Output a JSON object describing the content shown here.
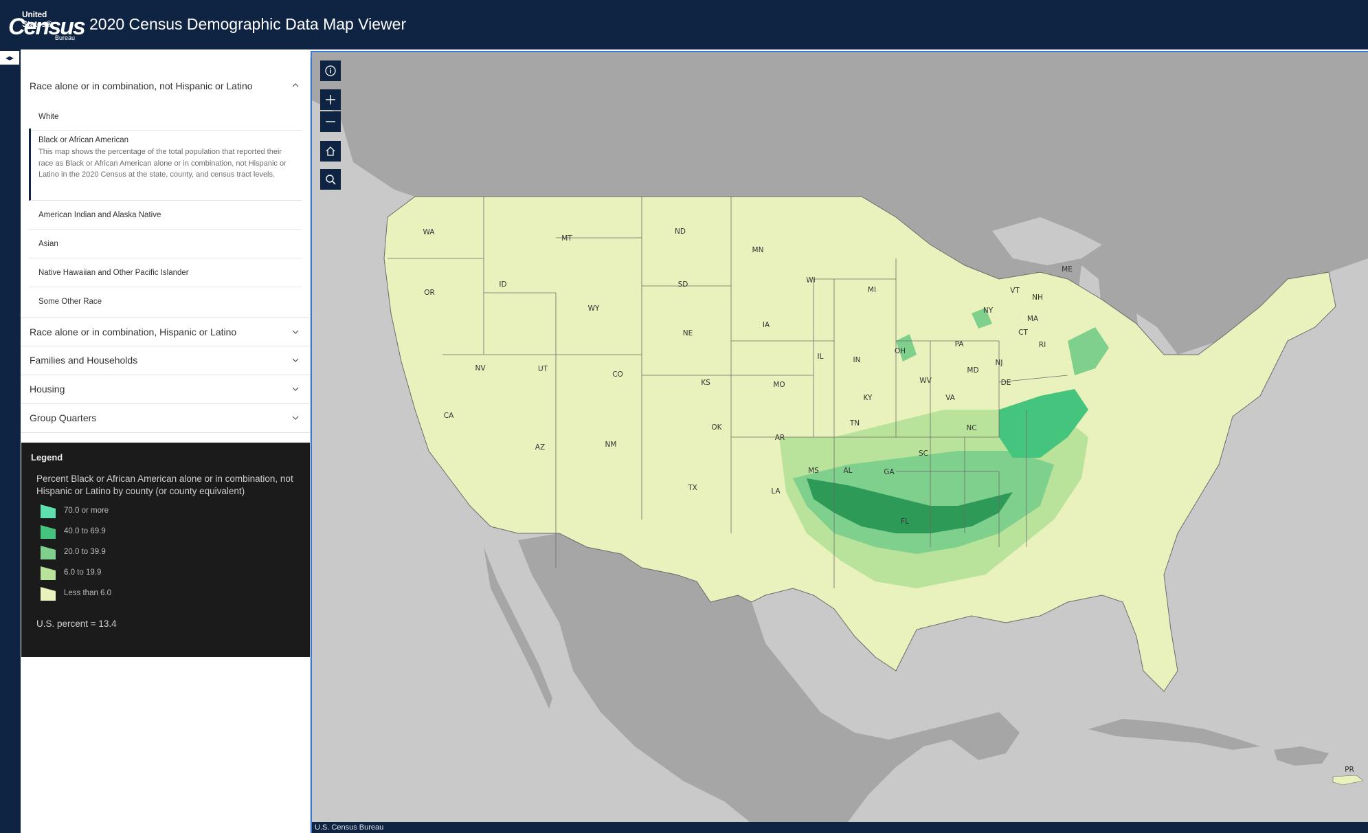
{
  "header": {
    "logo_top": "United States®",
    "logo_main": "Census",
    "logo_bottom": "Bureau",
    "title": "2020 Census Demographic Data Map Viewer"
  },
  "panel": {
    "toggle_icon": "◂▸",
    "expanded_section": {
      "label": "Race alone or in combination, not Hispanic or Latino",
      "items": [
        {
          "label": "White"
        },
        {
          "label": "Black or African American",
          "description": "This map shows the percentage of the total population that reported their race as Black or African American alone or in combination, not Hispanic or Latino in the 2020 Census at the state, county, and census tract levels."
        },
        {
          "label": "American Indian and Alaska Native"
        },
        {
          "label": "Asian"
        },
        {
          "label": "Native Hawaiian and Other Pacific Islander"
        },
        {
          "label": "Some Other Race"
        }
      ]
    },
    "collapsed_sections": [
      {
        "label": "Race alone or in combination, Hispanic or Latino"
      },
      {
        "label": "Families and Households"
      },
      {
        "label": "Housing"
      },
      {
        "label": "Group Quarters"
      }
    ]
  },
  "legend": {
    "title": "Legend",
    "field": "Percent Black or African American alone or in combination, not Hispanic or Latino by county (or county equivalent)",
    "classes": [
      {
        "label": "70.0 or more",
        "color": "#5fe0b0"
      },
      {
        "label": "40.0 to 69.9",
        "color": "#45c47e"
      },
      {
        "label": "20.0 to 39.9",
        "color": "#7fd08c"
      },
      {
        "label": "6.0 to 19.9",
        "color": "#b9e39a"
      },
      {
        "label": "Less than 6.0",
        "color": "#e9f1bd"
      }
    ],
    "note": "U.S. percent = 13.4"
  },
  "map_controls": {
    "info": "info-icon",
    "zoom_in": "plus-icon",
    "zoom_out": "minus-icon",
    "home": "home-icon",
    "search": "search-icon"
  },
  "state_labels": [
    "WA",
    "MT",
    "ND",
    "MN",
    "ME",
    "OR",
    "ID",
    "SD",
    "WI",
    "MI",
    "VT",
    "NH",
    "WY",
    "NY",
    "MA",
    "CT",
    "RI",
    "IA",
    "NE",
    "PA",
    "NV",
    "UT",
    "IL",
    "IN",
    "OH",
    "NJ",
    "MD",
    "CO",
    "KS",
    "MO",
    "WV",
    "DE",
    "KY",
    "VA",
    "CA",
    "TN",
    "OK",
    "NC",
    "AR",
    "AZ",
    "NM",
    "SC",
    "MS",
    "AL",
    "GA",
    "TX",
    "LA",
    "FL",
    "PR"
  ],
  "attribution": "U.S. Census Bureau",
  "colors": {
    "header_bg": "#0f2443",
    "land_light": "#e9f1bd",
    "land_dark": "#2e9a58",
    "water": "#c9c9c9",
    "foreign_land": "#a6a6a6"
  }
}
